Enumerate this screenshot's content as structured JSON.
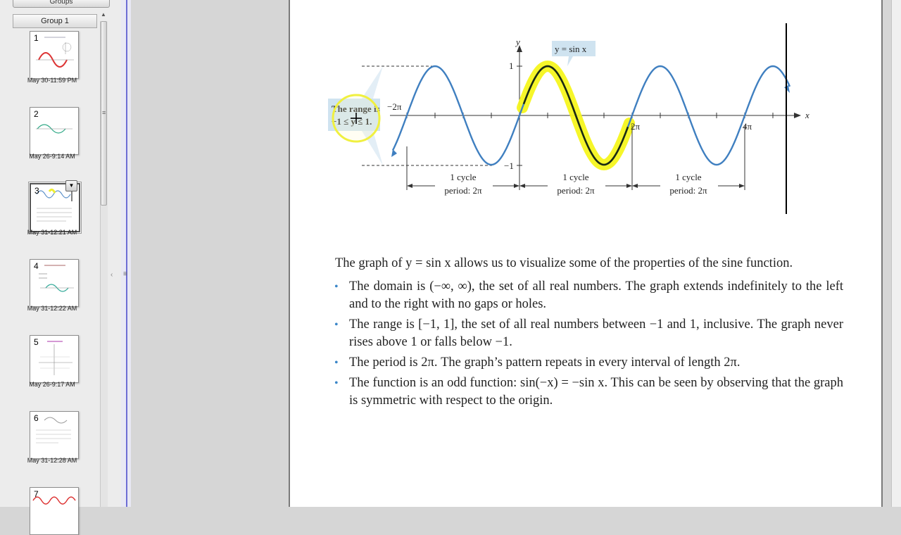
{
  "left_panel": {
    "groups_tab_label": "Groups",
    "group_header": "Group 1",
    "thumbnails": [
      {
        "number": "1",
        "date": "May 30-11:59 PM"
      },
      {
        "number": "2",
        "date": "May 26-9:14 AM"
      },
      {
        "number": "3",
        "date": "May 31-12:21 AM",
        "selected": true
      },
      {
        "number": "4",
        "date": "May 31-12:22 AM"
      },
      {
        "number": "5",
        "date": "May 26-9:17 AM"
      },
      {
        "number": "6",
        "date": "May 31-12:28 AM"
      },
      {
        "number": "7",
        "date": ""
      }
    ]
  },
  "graph": {
    "y_axis_label": "y",
    "x_axis_label": "x",
    "curve_label": "y = sin x",
    "y_tick_top": "1",
    "y_tick_bottom": "−1",
    "x_tick_neg": "−2π",
    "x_tick_2pi": "2π",
    "x_tick_4pi": "4π",
    "range_note_line1": "The range is",
    "range_note_line2": "−1 ≤ y ≤ 1.",
    "cycles": [
      {
        "label": "1 cycle",
        "period": "period: 2π"
      },
      {
        "label": "1 cycle",
        "period": "period: 2π"
      },
      {
        "label": "1 cycle",
        "period": "period: 2π"
      }
    ],
    "colors": {
      "curve": "#3f7fc0",
      "highlight": "#f5f51e",
      "callout": "#cfe3f0"
    }
  },
  "text": {
    "intro": "The graph of y = sin x allows us to visualize some of the properties of the sine function.",
    "bullets": [
      "The domain is (−∞, ∞), the set of all real numbers. The graph extends indefinitely to the left and to the right with no gaps or holes.",
      "The range is [−1, 1], the set of all real numbers between −1 and 1, inclusive. The graph never rises above 1 or falls below −1.",
      "The period is 2π. The graph’s pattern repeats in every interval of length 2π.",
      "The function is an odd function: sin(−x) = −sin x. This can be seen by observing that the graph is symmetric with respect to the origin."
    ],
    "bullet_symbol": "•"
  }
}
